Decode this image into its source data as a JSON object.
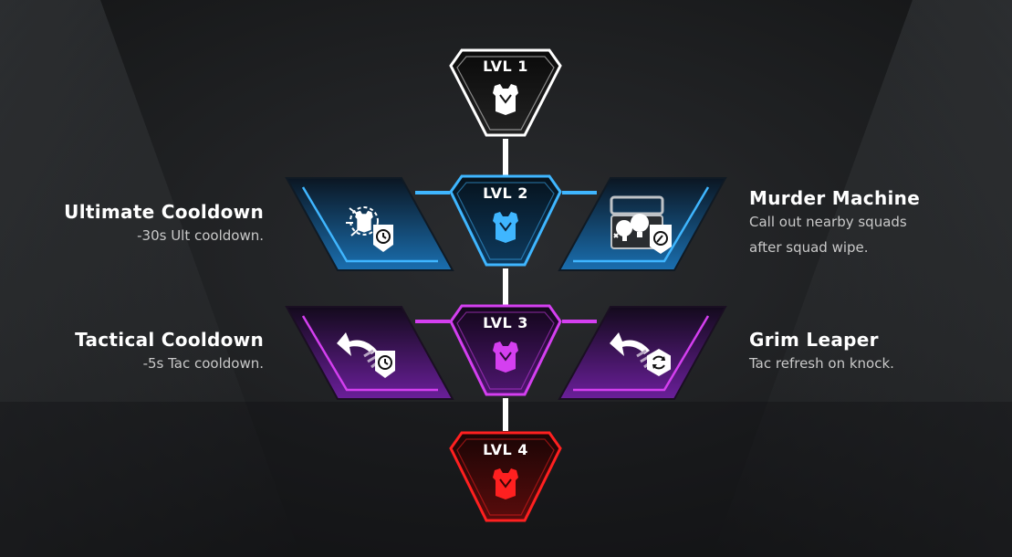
{
  "levels": [
    {
      "label": "LVL 1",
      "color": "#ffffff",
      "icon": "body-armor-icon"
    },
    {
      "label": "LVL 2",
      "color": "#3fb6ff",
      "icon": "body-armor-icon"
    },
    {
      "label": "LVL 3",
      "color": "#d43ff0",
      "icon": "body-armor-icon"
    },
    {
      "label": "LVL 4",
      "color": "#ff2020",
      "icon": "body-armor-icon"
    }
  ],
  "perks": {
    "lvl2_left": {
      "name": "Ultimate Cooldown",
      "desc": [
        "-30s Ult cooldown."
      ],
      "icon": "ultimate-cooldown-icon"
    },
    "lvl2_right": {
      "name": "Murder Machine",
      "desc": [
        "Call out nearby squads",
        "after squad wipe."
      ],
      "icon": "murder-machine-icon"
    },
    "lvl3_left": {
      "name": "Tactical Cooldown",
      "desc": [
        "-5s Tac cooldown."
      ],
      "icon": "tactical-cooldown-icon"
    },
    "lvl3_right": {
      "name": "Grim Leaper",
      "desc": [
        "Tac refresh on knock."
      ],
      "icon": "grim-leaper-icon"
    }
  }
}
